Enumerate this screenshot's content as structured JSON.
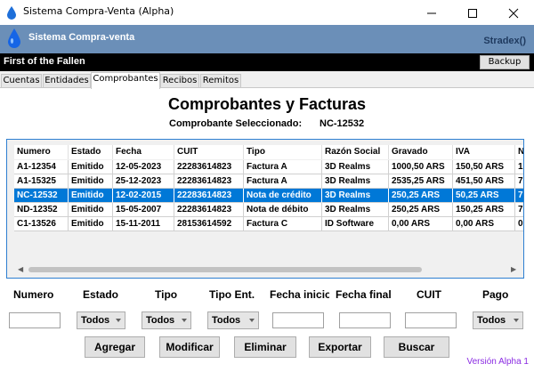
{
  "window": {
    "title": "Sistema Compra-Venta (Alpha)"
  },
  "header": {
    "app_name": "Sistema Compra-venta",
    "user": "Stradex()"
  },
  "bar": {
    "company": "First of the Fallen",
    "backup_label": "Backup"
  },
  "tabs": [
    {
      "label": "Cuentas",
      "active": false
    },
    {
      "label": "Entidades",
      "active": false
    },
    {
      "label": "Comprobantes",
      "active": true
    },
    {
      "label": "Recibos",
      "active": false
    },
    {
      "label": "Remitos",
      "active": false
    }
  ],
  "main": {
    "title": "Comprobantes y Facturas",
    "selected_label": "Comprobante Seleccionado:",
    "selected_value": "NC-12532"
  },
  "table": {
    "columns": [
      "Numero",
      "Estado",
      "Fecha",
      "CUIT",
      "Tipo",
      "Razón Social",
      "Gravado",
      "IVA",
      "N"
    ],
    "rows": [
      [
        "A1-12354",
        "Emitido",
        "12-05-2023",
        "22283614823",
        "Factura A",
        "3D Realms",
        "1000,50 ARS",
        "150,50 ARS",
        "1"
      ],
      [
        "A1-15325",
        "Emitido",
        "25-12-2023",
        "22283614823",
        "Factura A",
        "3D Realms",
        "2535,25 ARS",
        "451,50 ARS",
        "7"
      ],
      [
        "NC-12532",
        "Emitido",
        "12-02-2015",
        "22283614823",
        "Nota de crédito",
        "3D Realms",
        "250,25 ARS",
        "50,25 ARS",
        "7"
      ],
      [
        "ND-12352",
        "Emitido",
        "15-05-2007",
        "22283614823",
        "Nota de débito",
        "3D Realms",
        "250,25 ARS",
        "150,25 ARS",
        "7"
      ],
      [
        "C1-13526",
        "Emitido",
        "15-11-2011",
        "28153614592",
        "Factura C",
        "ID Software",
        "0,00 ARS",
        "0,00 ARS",
        "0"
      ]
    ],
    "selected_index": 2
  },
  "filters": {
    "numero_label": "Numero",
    "estado_label": "Estado",
    "tipo_label": "Tipo",
    "tipo_ent_label": "Tipo Ent.",
    "fecha_inicio_label": "Fecha inicio",
    "fecha_final_label": "Fecha final",
    "cuit_label": "CUIT",
    "pago_label": "Pago",
    "estado_value": "Todos",
    "tipo_value": "Todos",
    "tipo_ent_value": "Todos",
    "pago_value": "Todos"
  },
  "actions": {
    "agregar": "Agregar",
    "modificar": "Modificar",
    "eliminar": "Eliminar",
    "exportar": "Exportar",
    "buscar": "Buscar"
  },
  "footer": {
    "version": "Versión Alpha 1"
  },
  "colors": {
    "header_bg": "#6b8fb8",
    "selection": "#0078d7",
    "version_text": "#8a2be2"
  }
}
